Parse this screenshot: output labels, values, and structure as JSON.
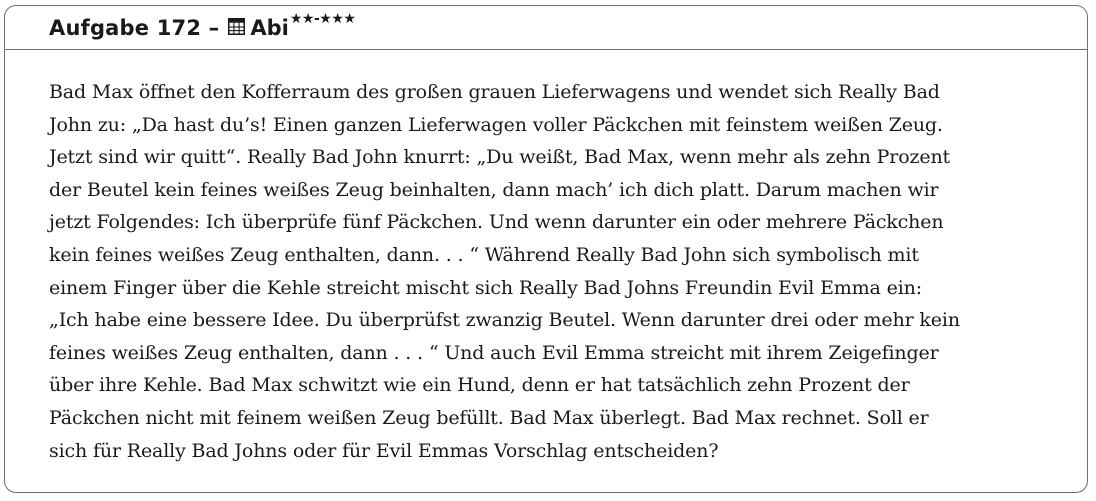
{
  "header": {
    "title": "Aufgabe 172 –",
    "icon": "calculator-icon",
    "abi": "Abi",
    "difficulty": "★★-★★★"
  },
  "body": {
    "lines": [
      "Bad Max öffnet den Kofferraum des großen grauen Lieferwagens und wendet sich Really Bad",
      "John zu: „Da hast du’s! Einen ganzen Lieferwagen voller Päckchen mit feinstem weißen Zeug.",
      "Jetzt sind wir quitt“. Really Bad John knurrt: „Du weißt, Bad Max, wenn mehr als zehn Prozent",
      "der Beutel kein feines weißes Zeug beinhalten, dann mach’ ich dich platt. Darum machen wir",
      "jetzt Folgendes: Ich überprüfe fünf Päckchen. Und wenn darunter ein oder mehrere Päckchen",
      "kein feines weißes Zeug enthalten, dann. . . “ Während Really Bad John sich symbolisch mit",
      "einem Finger über die Kehle streicht mischt sich Really Bad Johns Freundin Evil Emma ein:",
      "„Ich habe eine bessere Idee. Du überprüfst zwanzig Beutel. Wenn darunter drei oder mehr kein",
      "feines weißes Zeug enthalten, dann . . . “ Und auch Evil Emma streicht mit ihrem Zeigefinger",
      "über ihre Kehle. Bad Max schwitzt wie ein Hund, denn er hat tatsächlich zehn Prozent der",
      "Päckchen nicht mit feinem weißen Zeug befüllt. Bad Max überlegt. Bad Max rechnet. Soll er",
      "sich für Really Bad Johns oder für Evil Emmas Vorschlag entscheiden?"
    ]
  }
}
